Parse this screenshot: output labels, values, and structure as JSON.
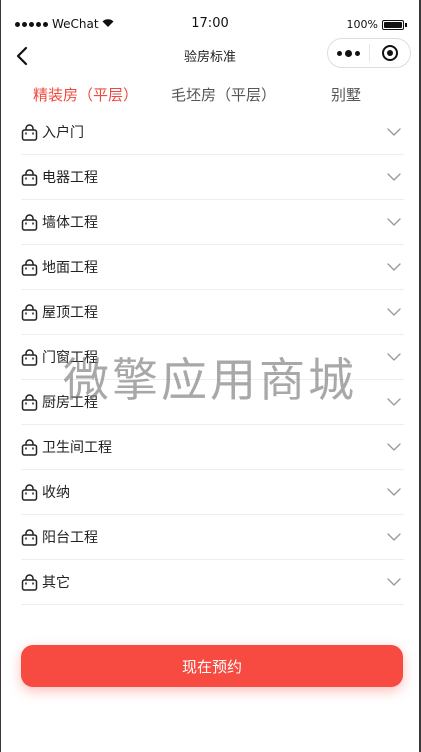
{
  "status_bar": {
    "carrier": "WeChat",
    "time": "17:00",
    "battery": "100%",
    "battery_level": 1.0
  },
  "nav": {
    "title": "验房标准",
    "back_icon": "chevron-left-icon",
    "more_icon": "more-dots-icon",
    "close_icon": "target-icon"
  },
  "tabs": [
    {
      "label": "精装房（平层）",
      "active": true
    },
    {
      "label": "毛坯房（平层）",
      "active": false
    },
    {
      "label": "别墅",
      "active": false
    }
  ],
  "items": [
    {
      "label": "入户门"
    },
    {
      "label": "电器工程"
    },
    {
      "label": "墙体工程"
    },
    {
      "label": "地面工程"
    },
    {
      "label": "屋顶工程"
    },
    {
      "label": "门窗工程"
    },
    {
      "label": "厨房工程"
    },
    {
      "label": "卫生间工程"
    },
    {
      "label": "收纳"
    },
    {
      "label": "阳台工程"
    },
    {
      "label": "其它"
    }
  ],
  "watermark": "微擎应用商城",
  "reserve_button": "现在预约",
  "colors": {
    "accent": "#f0483e",
    "button": "#f74a40"
  }
}
